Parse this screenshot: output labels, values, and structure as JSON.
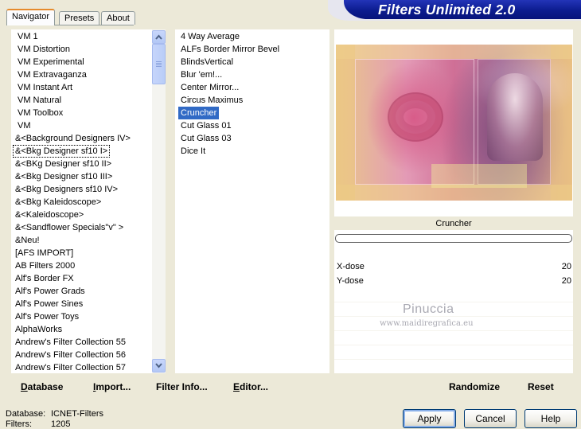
{
  "tabs": [
    "Navigator",
    "Presets",
    "About"
  ],
  "app_title": "Filters Unlimited 2.0",
  "categories": [
    "VM 1",
    "VM Distortion",
    "VM Experimental",
    "VM Extravaganza",
    "VM Instant Art",
    "VM Natural",
    "VM Toolbox",
    "VM",
    "&<Background Designers IV>",
    "&<Bkg Designer sf10 I>",
    "&<BKg Designer sf10 II>",
    "&<Bkg Designer sf10 III>",
    "&<Bkg Designers sf10 IV>",
    "&<Bkg Kaleidoscope>",
    "&<Kaleidoscope>",
    "&<Sandflower Specials\"v\" >",
    "&Neu!",
    "[AFS IMPORT]",
    "AB Filters 2000",
    "Alf's Border FX",
    "Alf's Power Grads",
    "Alf's Power Sines",
    "Alf's Power Toys",
    "AlphaWorks",
    "Andrew's Filter Collection 55",
    "Andrew's Filter Collection 56",
    "Andrew's Filter Collection 57"
  ],
  "selected_category_index": 9,
  "filters": [
    "4 Way Average",
    "ALFs Border Mirror Bevel",
    "BlindsVertical",
    "Blur 'em!...",
    "Center Mirror...",
    "Circus Maximus",
    "Cruncher",
    "Cut Glass 01",
    "Cut Glass 03",
    "Dice It"
  ],
  "selected_filter_index": 6,
  "preview": {
    "filter_name": "Cruncher",
    "watermark_title": "Pinuccia",
    "watermark_url": "www.maidiregrafica.eu",
    "progress": 0
  },
  "params": [
    {
      "label": "X-dose",
      "value": "20"
    },
    {
      "label": "Y-dose",
      "value": "20"
    }
  ],
  "bottom_left_buttons": [
    {
      "label": "Database",
      "underline": "D",
      "rest": "atabase"
    },
    {
      "label": "Import...",
      "underline": "I",
      "rest": "mport..."
    },
    {
      "label": "Filter Info...",
      "underline": "",
      "rest": "Filter Info..."
    },
    {
      "label": "Editor...",
      "underline": "E",
      "rest": "ditor..."
    }
  ],
  "bottom_right_buttons": [
    "Randomize",
    "Reset"
  ],
  "status": {
    "database_label": "Database:",
    "database_value": "ICNET-Filters",
    "filters_label": "Filters:",
    "filters_value": "1205"
  },
  "dialog_buttons": [
    "Apply",
    "Cancel",
    "Help"
  ],
  "colors": {
    "window_bg": "#ece9d8",
    "selection": "#316ac5",
    "banner": "#0c1c8f",
    "active_tab_accent": "#e68b2c"
  }
}
